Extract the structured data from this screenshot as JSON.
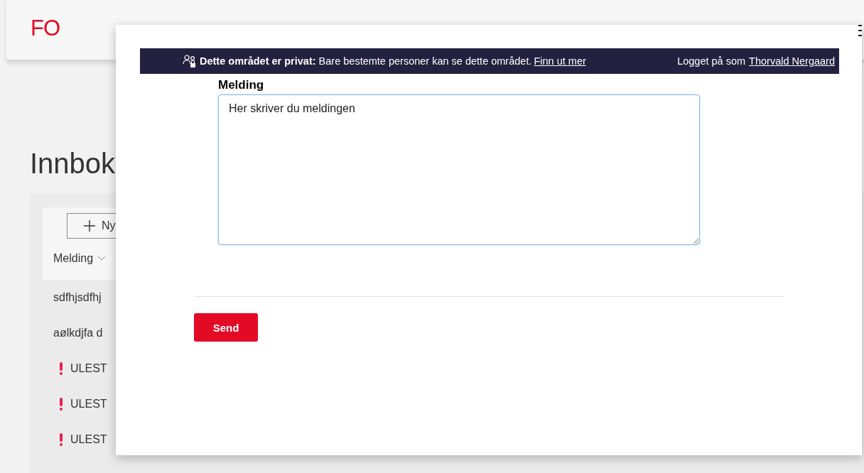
{
  "header": {
    "logo": "FO"
  },
  "page": {
    "title": "Innbok",
    "new_button": "Ny",
    "column_header": "Melding",
    "rows": [
      {
        "kind": "text",
        "text": "sdfhjsdfhj"
      },
      {
        "kind": "text",
        "text": "aølkdjfa d"
      },
      {
        "kind": "unread",
        "text": "ULEST"
      },
      {
        "kind": "unread",
        "text": "ULEST"
      },
      {
        "kind": "unread",
        "text": "ULEST"
      }
    ]
  },
  "dialog": {
    "banner": {
      "notice": "**Dette området er privat:** Bare bestemte personer kan se dette området.",
      "link": "Finn ut mer",
      "signed_in": "Logget på som",
      "user": "Thorvald Nergaard"
    },
    "field": {
      "label": "Melding",
      "value": "Her skriver du meldingen"
    },
    "send_button": "Send"
  }
}
